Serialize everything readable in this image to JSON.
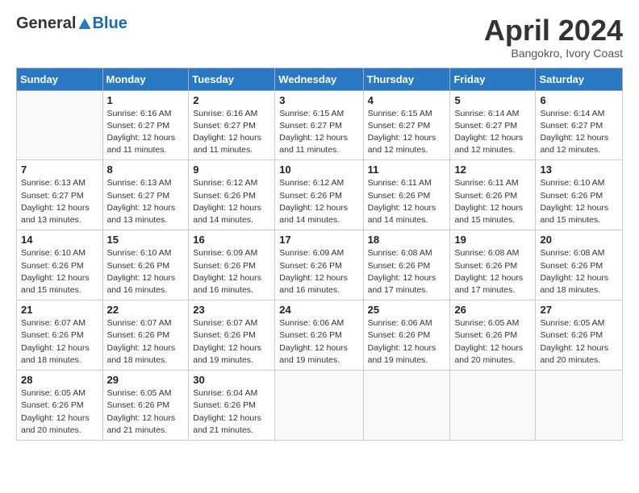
{
  "header": {
    "logo_general": "General",
    "logo_blue": "Blue",
    "title": "April 2024",
    "location": "Bangokro, Ivory Coast"
  },
  "days_of_week": [
    "Sunday",
    "Monday",
    "Tuesday",
    "Wednesday",
    "Thursday",
    "Friday",
    "Saturday"
  ],
  "weeks": [
    [
      {
        "day": "",
        "info": ""
      },
      {
        "day": "1",
        "info": "Sunrise: 6:16 AM\nSunset: 6:27 PM\nDaylight: 12 hours\nand 11 minutes."
      },
      {
        "day": "2",
        "info": "Sunrise: 6:16 AM\nSunset: 6:27 PM\nDaylight: 12 hours\nand 11 minutes."
      },
      {
        "day": "3",
        "info": "Sunrise: 6:15 AM\nSunset: 6:27 PM\nDaylight: 12 hours\nand 11 minutes."
      },
      {
        "day": "4",
        "info": "Sunrise: 6:15 AM\nSunset: 6:27 PM\nDaylight: 12 hours\nand 12 minutes."
      },
      {
        "day": "5",
        "info": "Sunrise: 6:14 AM\nSunset: 6:27 PM\nDaylight: 12 hours\nand 12 minutes."
      },
      {
        "day": "6",
        "info": "Sunrise: 6:14 AM\nSunset: 6:27 PM\nDaylight: 12 hours\nand 12 minutes."
      }
    ],
    [
      {
        "day": "7",
        "info": "Sunrise: 6:13 AM\nSunset: 6:27 PM\nDaylight: 12 hours\nand 13 minutes."
      },
      {
        "day": "8",
        "info": "Sunrise: 6:13 AM\nSunset: 6:27 PM\nDaylight: 12 hours\nand 13 minutes."
      },
      {
        "day": "9",
        "info": "Sunrise: 6:12 AM\nSunset: 6:26 PM\nDaylight: 12 hours\nand 14 minutes."
      },
      {
        "day": "10",
        "info": "Sunrise: 6:12 AM\nSunset: 6:26 PM\nDaylight: 12 hours\nand 14 minutes."
      },
      {
        "day": "11",
        "info": "Sunrise: 6:11 AM\nSunset: 6:26 PM\nDaylight: 12 hours\nand 14 minutes."
      },
      {
        "day": "12",
        "info": "Sunrise: 6:11 AM\nSunset: 6:26 PM\nDaylight: 12 hours\nand 15 minutes."
      },
      {
        "day": "13",
        "info": "Sunrise: 6:10 AM\nSunset: 6:26 PM\nDaylight: 12 hours\nand 15 minutes."
      }
    ],
    [
      {
        "day": "14",
        "info": "Sunrise: 6:10 AM\nSunset: 6:26 PM\nDaylight: 12 hours\nand 15 minutes."
      },
      {
        "day": "15",
        "info": "Sunrise: 6:10 AM\nSunset: 6:26 PM\nDaylight: 12 hours\nand 16 minutes."
      },
      {
        "day": "16",
        "info": "Sunrise: 6:09 AM\nSunset: 6:26 PM\nDaylight: 12 hours\nand 16 minutes."
      },
      {
        "day": "17",
        "info": "Sunrise: 6:09 AM\nSunset: 6:26 PM\nDaylight: 12 hours\nand 16 minutes."
      },
      {
        "day": "18",
        "info": "Sunrise: 6:08 AM\nSunset: 6:26 PM\nDaylight: 12 hours\nand 17 minutes."
      },
      {
        "day": "19",
        "info": "Sunrise: 6:08 AM\nSunset: 6:26 PM\nDaylight: 12 hours\nand 17 minutes."
      },
      {
        "day": "20",
        "info": "Sunrise: 6:08 AM\nSunset: 6:26 PM\nDaylight: 12 hours\nand 18 minutes."
      }
    ],
    [
      {
        "day": "21",
        "info": "Sunrise: 6:07 AM\nSunset: 6:26 PM\nDaylight: 12 hours\nand 18 minutes."
      },
      {
        "day": "22",
        "info": "Sunrise: 6:07 AM\nSunset: 6:26 PM\nDaylight: 12 hours\nand 18 minutes."
      },
      {
        "day": "23",
        "info": "Sunrise: 6:07 AM\nSunset: 6:26 PM\nDaylight: 12 hours\nand 19 minutes."
      },
      {
        "day": "24",
        "info": "Sunrise: 6:06 AM\nSunset: 6:26 PM\nDaylight: 12 hours\nand 19 minutes."
      },
      {
        "day": "25",
        "info": "Sunrise: 6:06 AM\nSunset: 6:26 PM\nDaylight: 12 hours\nand 19 minutes."
      },
      {
        "day": "26",
        "info": "Sunrise: 6:05 AM\nSunset: 6:26 PM\nDaylight: 12 hours\nand 20 minutes."
      },
      {
        "day": "27",
        "info": "Sunrise: 6:05 AM\nSunset: 6:26 PM\nDaylight: 12 hours\nand 20 minutes."
      }
    ],
    [
      {
        "day": "28",
        "info": "Sunrise: 6:05 AM\nSunset: 6:26 PM\nDaylight: 12 hours\nand 20 minutes."
      },
      {
        "day": "29",
        "info": "Sunrise: 6:05 AM\nSunset: 6:26 PM\nDaylight: 12 hours\nand 21 minutes."
      },
      {
        "day": "30",
        "info": "Sunrise: 6:04 AM\nSunset: 6:26 PM\nDaylight: 12 hours\nand 21 minutes."
      },
      {
        "day": "",
        "info": ""
      },
      {
        "day": "",
        "info": ""
      },
      {
        "day": "",
        "info": ""
      },
      {
        "day": "",
        "info": ""
      }
    ]
  ]
}
